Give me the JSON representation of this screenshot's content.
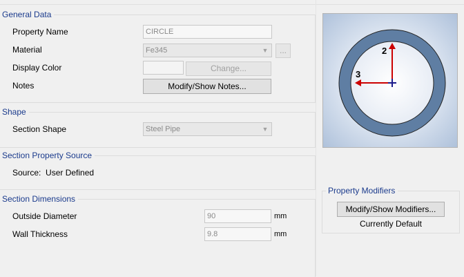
{
  "general_data": {
    "title": "General Data",
    "property_name_label": "Property Name",
    "property_name_value": "CIRCLE",
    "material_label": "Material",
    "material_value": "Fe345",
    "material_button": "...",
    "display_color_label": "Display Color",
    "change_button": "Change...",
    "notes_label": "Notes",
    "notes_button": "Modify/Show Notes..."
  },
  "shape": {
    "title": "Shape",
    "section_shape_label": "Section Shape",
    "section_shape_value": "Steel Pipe"
  },
  "section_property_source": {
    "title": "Section Property Source",
    "source_text": "Source:  User Defined"
  },
  "section_dimensions": {
    "title": "Section Dimensions",
    "outside_diameter_label": "Outside Diameter",
    "outside_diameter_value": "90",
    "outside_diameter_unit": "mm",
    "wall_thickness_label": "Wall Thickness",
    "wall_thickness_value": "9.8",
    "wall_thickness_unit": "mm"
  },
  "preview": {
    "axis_2_label": "2",
    "axis_3_label": "3",
    "ring_color": "#5f7ea3",
    "axis_color": "#cc0000",
    "origin_color": "#1a1a8c"
  },
  "property_modifiers": {
    "title": "Property Modifiers",
    "button": "Modify/Show Modifiers...",
    "status": "Currently Default"
  }
}
